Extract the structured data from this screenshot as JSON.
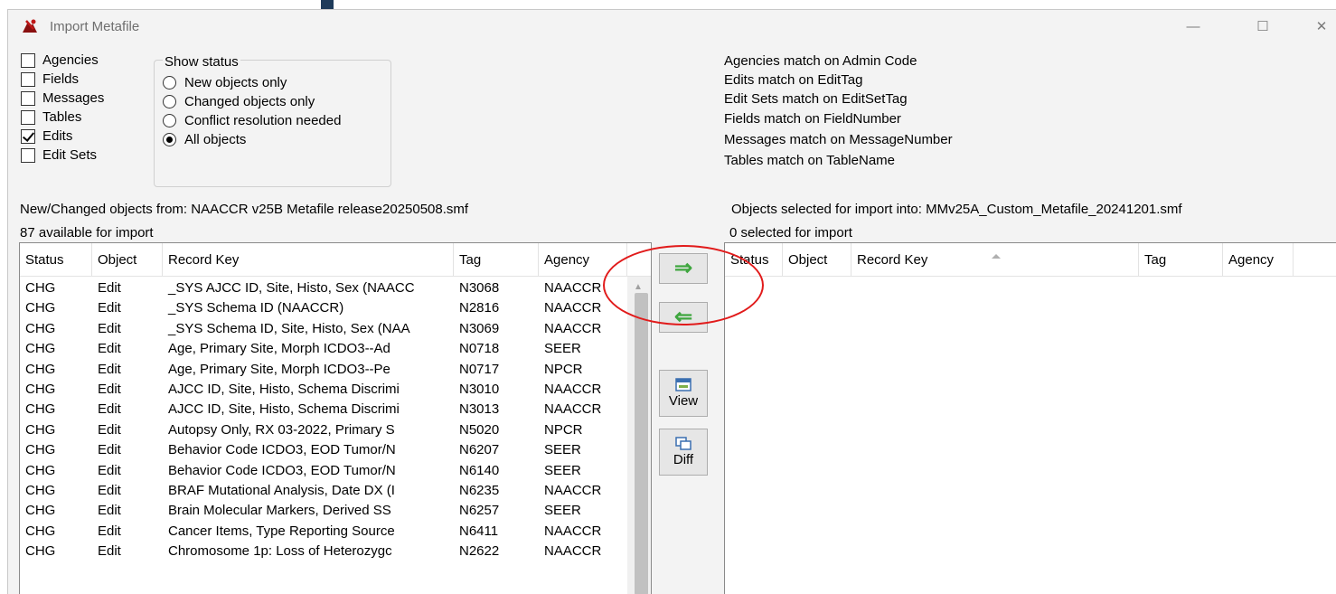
{
  "window": {
    "title": "Import Metafile",
    "minimize_glyph": "—",
    "maximize_glyph": "☐",
    "close_glyph": "✕"
  },
  "object_types": [
    {
      "label": "Agencies",
      "checked": false
    },
    {
      "label": "Fields",
      "checked": false
    },
    {
      "label": "Messages",
      "checked": false
    },
    {
      "label": "Tables",
      "checked": false
    },
    {
      "label": "Edits",
      "checked": true
    },
    {
      "label": "Edit Sets",
      "checked": false
    }
  ],
  "show_status": {
    "title": "Show status",
    "options": [
      {
        "label": "New objects only",
        "selected": false
      },
      {
        "label": "Changed objects only",
        "selected": false
      },
      {
        "label": "Conflict resolution needed",
        "selected": false
      },
      {
        "label": "All objects",
        "selected": true
      }
    ]
  },
  "match_rules": [
    "Agencies match on Admin Code",
    "Edits match on EditTag",
    "Edit Sets match on EditSetTag",
    "Fields match on FieldNumber",
    "Messages match on MessageNumber",
    "Tables match on TableName"
  ],
  "source": {
    "header": "New/Changed objects from: NAACCR v25B Metafile release20250508.smf",
    "count_text": "87 available for import"
  },
  "target": {
    "header": "Objects selected for import into: MMv25A_Custom_Metafile_20241201.smf",
    "count_text": "0 selected for import"
  },
  "columns": [
    "Status",
    "Object",
    "Record Key",
    "Tag",
    "Agency"
  ],
  "source_rows": [
    [
      "CHG",
      "Edit",
      "_SYS AJCC ID, Site, Histo, Sex (NAACC",
      "N3068",
      "NAACCR"
    ],
    [
      "CHG",
      "Edit",
      "_SYS Schema ID (NAACCR)",
      "N2816",
      "NAACCR"
    ],
    [
      "CHG",
      "Edit",
      "_SYS Schema ID, Site, Histo, Sex (NAA",
      "N3069",
      "NAACCR"
    ],
    [
      "CHG",
      "Edit",
      "Age, Primary Site, Morph ICDO3--Ad",
      "N0718",
      "SEER"
    ],
    [
      "CHG",
      "Edit",
      "Age, Primary Site, Morph ICDO3--Pe",
      "N0717",
      "NPCR"
    ],
    [
      "CHG",
      "Edit",
      "AJCC ID, Site, Histo, Schema Discrimi",
      "N3010",
      "NAACCR"
    ],
    [
      "CHG",
      "Edit",
      "AJCC ID, Site, Histo, Schema Discrimi",
      "N3013",
      "NAACCR"
    ],
    [
      "CHG",
      "Edit",
      "Autopsy Only, RX 03-2022, Primary S",
      "N5020",
      "NPCR"
    ],
    [
      "CHG",
      "Edit",
      "Behavior Code ICDO3, EOD Tumor/N",
      "N6207",
      "SEER"
    ],
    [
      "CHG",
      "Edit",
      "Behavior Code ICDO3, EOD Tumor/N",
      "N6140",
      "SEER"
    ],
    [
      "CHG",
      "Edit",
      "BRAF Mutational Analysis, Date DX (I",
      "N6235",
      "NAACCR"
    ],
    [
      "CHG",
      "Edit",
      "Brain Molecular Markers, Derived SS",
      "N6257",
      "SEER"
    ],
    [
      "CHG",
      "Edit",
      "Cancer Items, Type Reporting Source",
      "N6411",
      "NAACCR"
    ],
    [
      "CHG",
      "Edit",
      "Chromosome 1p: Loss of Heterozygc",
      "N2622",
      "NAACCR"
    ]
  ],
  "buttons": {
    "add_arrow": "⇒",
    "remove_arrow": "⇐",
    "view": "View",
    "diff": "Diff"
  },
  "colors": {
    "arrow_green": "#3fa63f",
    "highlight_ellipse": "#e11b1b",
    "window_bg": "#f3f3f3"
  }
}
